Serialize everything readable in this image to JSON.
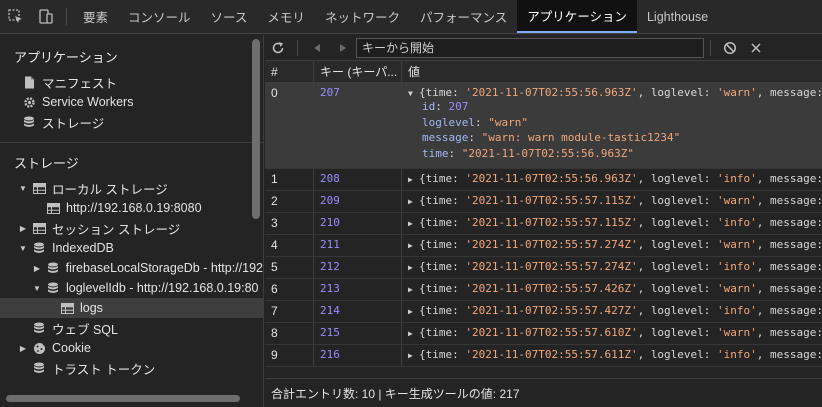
{
  "topbar": {
    "tabs": [
      {
        "label": "要素",
        "name": "tab-elements"
      },
      {
        "label": "コンソール",
        "name": "tab-console"
      },
      {
        "label": "ソース",
        "name": "tab-sources"
      },
      {
        "label": "メモリ",
        "name": "tab-memory"
      },
      {
        "label": "ネットワーク",
        "name": "tab-network"
      },
      {
        "label": "パフォーマンス",
        "name": "tab-performance"
      },
      {
        "label": "アプリケーション",
        "name": "tab-application"
      },
      {
        "label": "Lighthouse",
        "name": "tab-lighthouse"
      }
    ],
    "active_index": 6
  },
  "sidebar": {
    "application_title": "アプリケーション",
    "application_items": [
      {
        "label": "マニフェスト",
        "icon": "file-icon"
      },
      {
        "label": "Service Workers",
        "icon": "gear-icon"
      },
      {
        "label": "ストレージ",
        "icon": "database-icon"
      }
    ],
    "storage_title": "ストレージ",
    "storage_items": [
      {
        "label": "ローカル ストレージ",
        "icon": "grid-icon",
        "arrow": "down",
        "indent": 0
      },
      {
        "label": "http://192.168.0.19:8080",
        "icon": "grid-icon",
        "arrow": "",
        "indent": 1
      },
      {
        "label": "セッション ストレージ",
        "icon": "grid-icon",
        "arrow": "right",
        "indent": 0
      },
      {
        "label": "IndexedDB",
        "icon": "database-icon",
        "arrow": "down",
        "indent": 0
      },
      {
        "label": "firebaseLocalStorageDb - http://192",
        "icon": "database-icon",
        "arrow": "right",
        "indent": 1
      },
      {
        "label": "loglevelIdb - http://192.168.0.19:80",
        "icon": "database-icon",
        "arrow": "down",
        "indent": 1
      },
      {
        "label": "logs",
        "icon": "grid-icon",
        "arrow": "",
        "indent": 2,
        "selected": true
      },
      {
        "label": "ウェブ SQL",
        "icon": "database-icon",
        "arrow": "",
        "indent": 0
      },
      {
        "label": "Cookie",
        "icon": "cookie-icon",
        "arrow": "right",
        "indent": 0
      },
      {
        "label": "トラスト トークン",
        "icon": "database-icon",
        "arrow": "",
        "indent": 0
      }
    ]
  },
  "toolbar": {
    "filter_placeholder": "キーから開始"
  },
  "grid": {
    "columns": [
      "#",
      "キー (キーパ...",
      "値"
    ],
    "expanded": {
      "index": "0",
      "key": "207",
      "summary": {
        "time": "'2021-11-07T02:55:56.963Z'",
        "loglevel": "'warn'",
        "message": "message:"
      },
      "fields": [
        {
          "k": "id",
          "v": "207",
          "type": "num"
        },
        {
          "k": "loglevel",
          "v": "\"warn\"",
          "type": "str"
        },
        {
          "k": "message",
          "v": "\"warn: warn module-tastic1234\"",
          "type": "str"
        },
        {
          "k": "time",
          "v": "\"2021-11-07T02:55:56.963Z\"",
          "type": "str"
        }
      ]
    },
    "rows": [
      {
        "index": "1",
        "key": "208",
        "time": "'2021-11-07T02:55:56.963Z'",
        "loglevel": "'info'"
      },
      {
        "index": "2",
        "key": "209",
        "time": "'2021-11-07T02:55:57.115Z'",
        "loglevel": "'warn'"
      },
      {
        "index": "3",
        "key": "210",
        "time": "'2021-11-07T02:55:57.115Z'",
        "loglevel": "'info'"
      },
      {
        "index": "4",
        "key": "211",
        "time": "'2021-11-07T02:55:57.274Z'",
        "loglevel": "'warn'"
      },
      {
        "index": "5",
        "key": "212",
        "time": "'2021-11-07T02:55:57.274Z'",
        "loglevel": "'info'"
      },
      {
        "index": "6",
        "key": "213",
        "time": "'2021-11-07T02:55:57.426Z'",
        "loglevel": "'warn'"
      },
      {
        "index": "7",
        "key": "214",
        "time": "'2021-11-07T02:55:57.427Z'",
        "loglevel": "'info'"
      },
      {
        "index": "8",
        "key": "215",
        "time": "'2021-11-07T02:55:57.610Z'",
        "loglevel": "'warn'"
      },
      {
        "index": "9",
        "key": "216",
        "time": "'2021-11-07T02:55:57.611Z'",
        "loglevel": "'info'"
      }
    ],
    "labels": {
      "time": "time:",
      "loglevel": "loglevel:",
      "message": "message:"
    }
  },
  "footer": {
    "text": "合計エントリ数: 10 | キー生成ツールの値: 217"
  }
}
